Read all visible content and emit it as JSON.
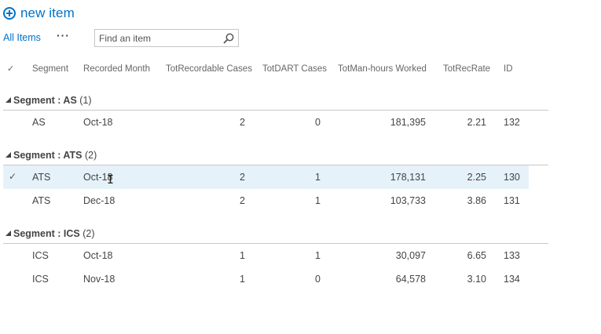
{
  "toolbar": {
    "new_item_label": "new item"
  },
  "views": {
    "current": "All Items",
    "more": "···"
  },
  "search": {
    "placeholder": "Find an item"
  },
  "columns": {
    "check": "✓",
    "segment": "Segment",
    "recorded_month": "Recorded Month",
    "tot_recordable": "TotRecordable Cases",
    "tot_dart": "TotDART Cases",
    "tot_manhours": "TotMan-hours Worked",
    "tot_rec_rate": "TotRecRate",
    "id": "ID"
  },
  "groups": [
    {
      "label": "Segment : AS",
      "count": "(1)",
      "rows": [
        {
          "segment": "AS",
          "month": "Oct-18",
          "recordable": "2",
          "dart": "0",
          "manhours": "181,395",
          "rate": "2.21",
          "id": "132",
          "selected": false
        }
      ]
    },
    {
      "label": "Segment : ATS",
      "count": "(2)",
      "rows": [
        {
          "segment": "ATS",
          "month": "Oct-18",
          "recordable": "2",
          "dart": "1",
          "manhours": "178,131",
          "rate": "2.25",
          "id": "130",
          "selected": true
        },
        {
          "segment": "ATS",
          "month": "Dec-18",
          "recordable": "2",
          "dart": "1",
          "manhours": "103,733",
          "rate": "3.86",
          "id": "131",
          "selected": false
        }
      ]
    },
    {
      "label": "Segment : ICS",
      "count": "(2)",
      "rows": [
        {
          "segment": "ICS",
          "month": "Oct-18",
          "recordable": "1",
          "dart": "1",
          "manhours": "30,097",
          "rate": "6.65",
          "id": "133",
          "selected": false
        },
        {
          "segment": "ICS",
          "month": "Nov-18",
          "recordable": "1",
          "dart": "0",
          "manhours": "64,578",
          "rate": "3.10",
          "id": "134",
          "selected": false
        }
      ]
    }
  ],
  "selected_check": "✓"
}
